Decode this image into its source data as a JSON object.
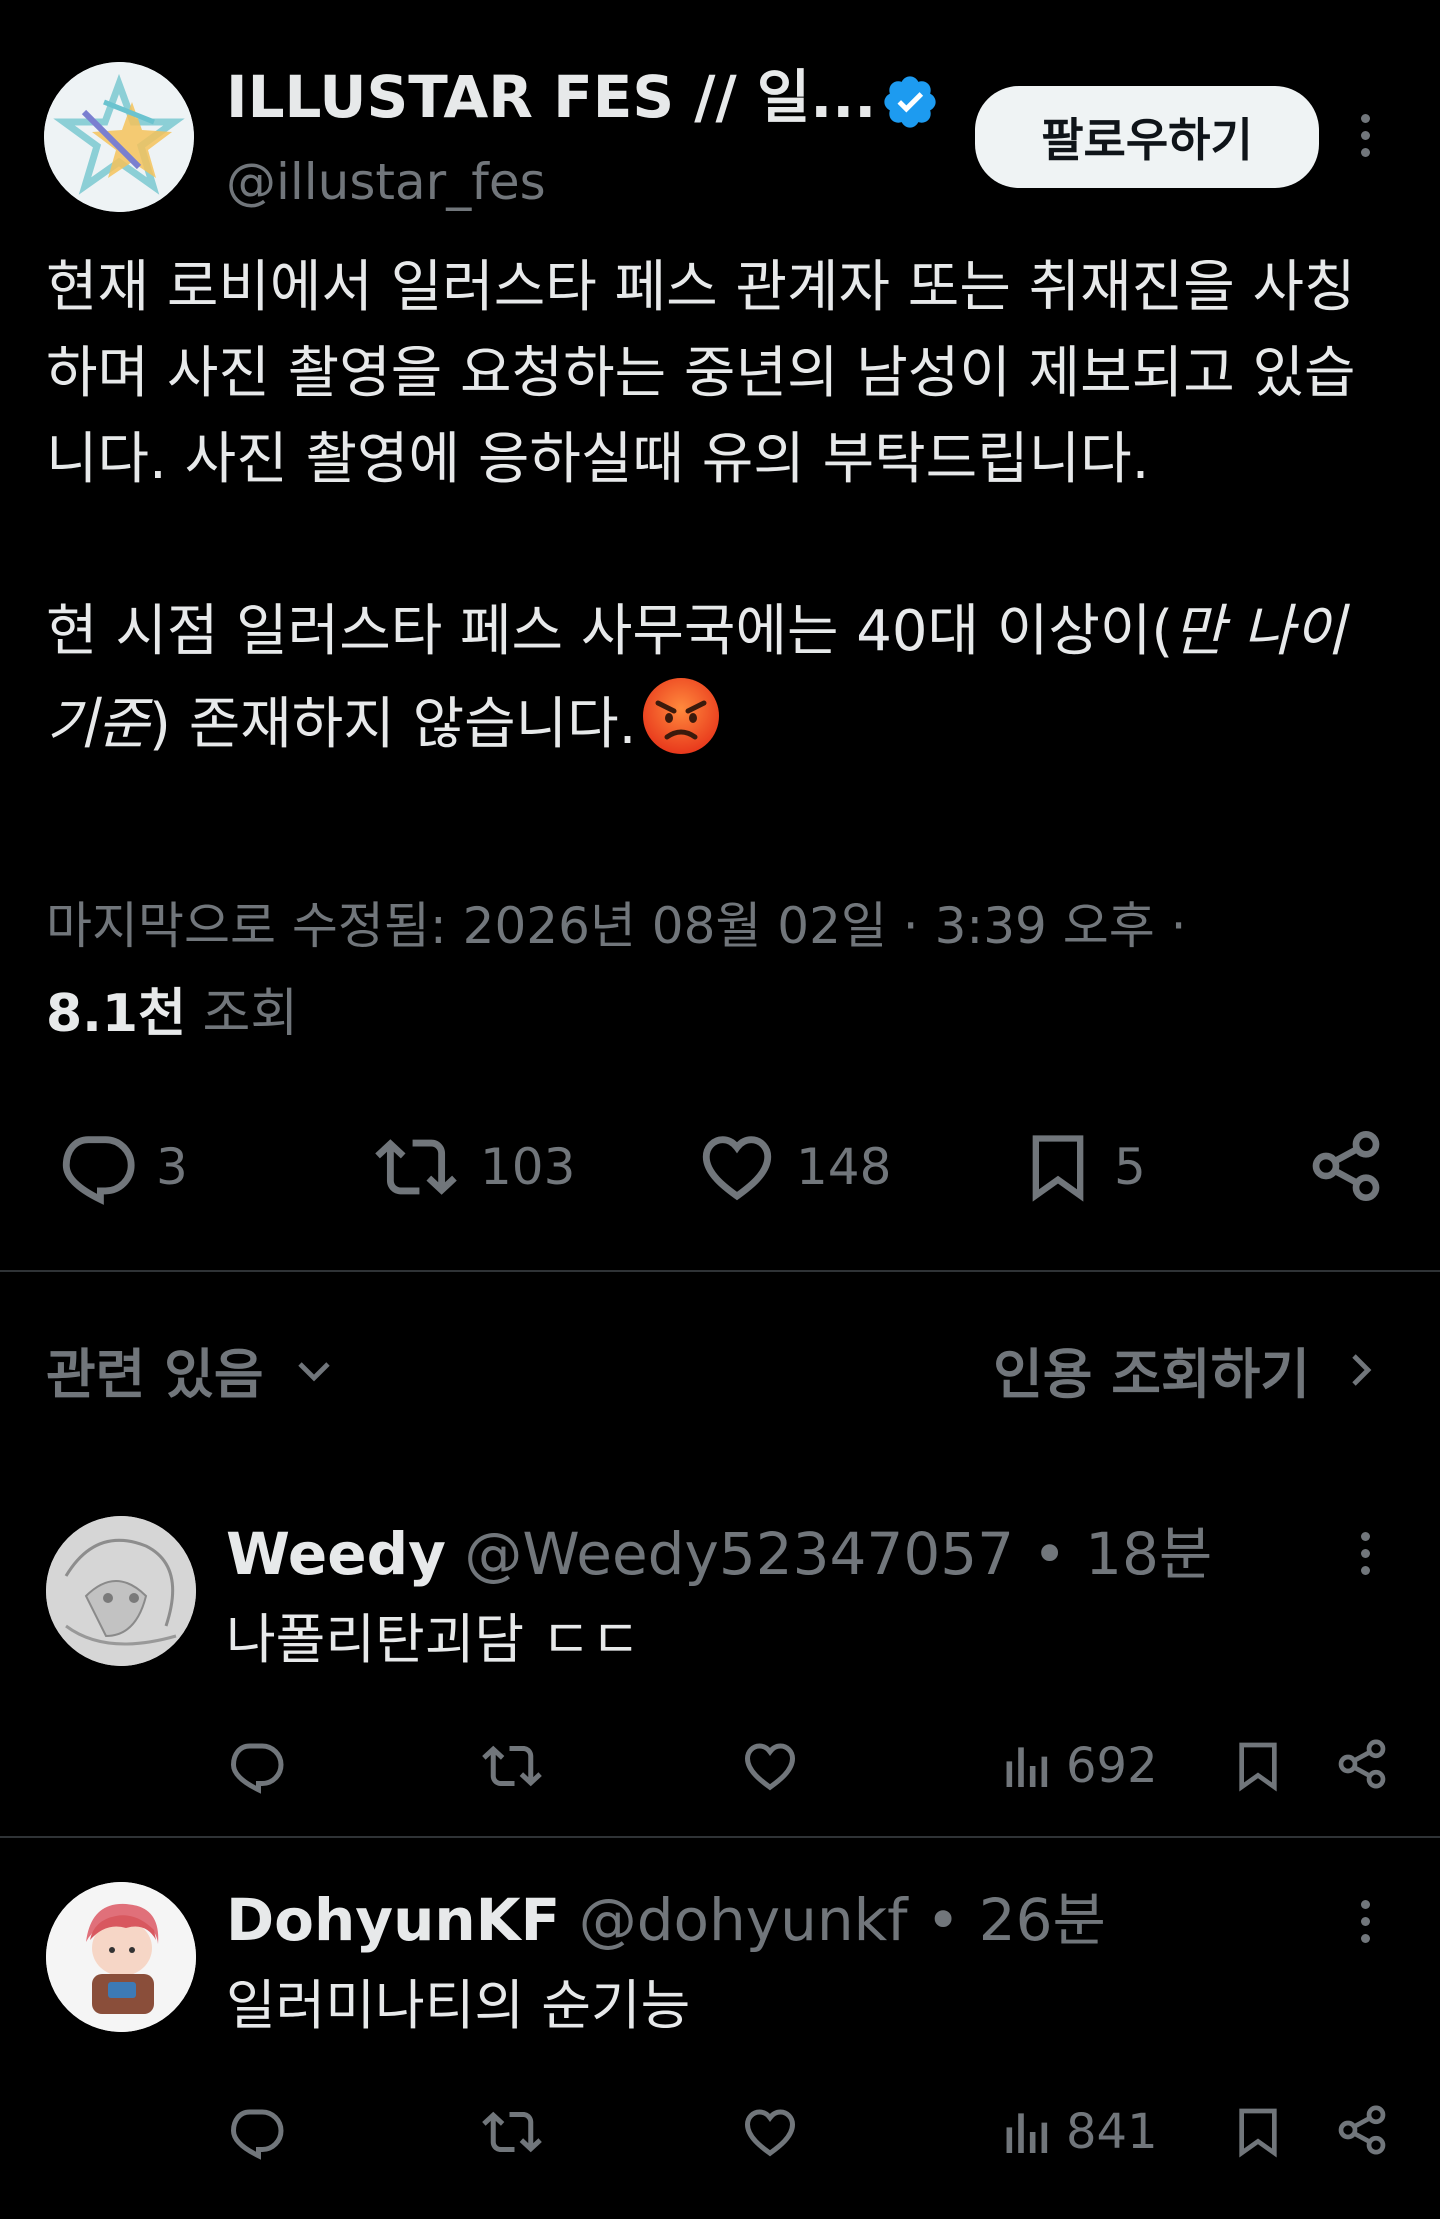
{
  "main_tweet": {
    "author_name": "ILLUSTAR FES // 일...",
    "handle": "@illustar_fes",
    "follow_label": "팔로우하기",
    "text_para1": "현재 로비에서 일러스타 페스 관계자 또는 취재진을 사칭하며 사진 촬영을 요청하는 중년의 남성이 제보되고 있습니다. 사진 촬영에 응하실때 유의 부탁드립니다.",
    "text_para2_start": "현 시점 일러스타 페스 사무국에는 40대 이상이(",
    "text_para2_italic": "만 나이 기준",
    "text_para2_end": ") 존재하지 않습니다.",
    "edited_label": "마지막으로 수정됨: 2026년 08월 02일 · 3:39 오후 ·",
    "views_count": "8.1천",
    "views_label": "조회",
    "replies": "3",
    "retweets": "103",
    "likes": "148",
    "bookmarks": "5"
  },
  "bar": {
    "relevance_label": "관련 있음",
    "quotes_label": "인용 조회하기"
  },
  "replies": [
    {
      "name": "Weedy",
      "handle": "@Weedy52347057",
      "time": "• 18분",
      "text": "나폴리탄괴담 ㄷㄷ",
      "views": "692"
    },
    {
      "name": "DohyunKF",
      "handle": "@dohyunkf",
      "time": "• 26분",
      "text": "일러미나티의 순기능",
      "views": "841"
    }
  ],
  "colors": {
    "background": "#000000",
    "text": "#e7e9ea",
    "muted": "#71767b",
    "verified": "#1d9bf0",
    "divider": "#2f3336"
  },
  "icons": [
    "verified-badge-icon",
    "more-icon",
    "reply-icon",
    "retweet-icon",
    "like-icon",
    "bookmark-icon",
    "share-icon",
    "chevron-down-icon",
    "chevron-right-icon",
    "views-icon",
    "angry-face-emoji"
  ]
}
